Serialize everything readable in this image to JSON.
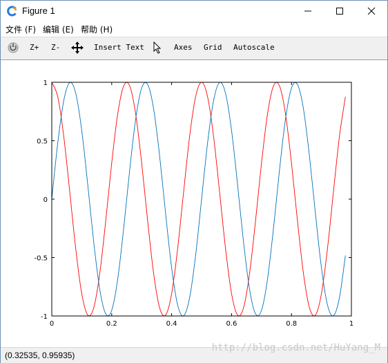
{
  "window": {
    "title": "Figure 1"
  },
  "menu": {
    "items": [
      "文件 (F)",
      "编辑 (E)",
      "帮助 (H)"
    ]
  },
  "toolbar": {
    "zoom_in": "Z+",
    "zoom_out": "Z-",
    "insert_text": "Insert Text",
    "axes": "Axes",
    "grid": "Grid",
    "autoscale": "Autoscale"
  },
  "status": {
    "coords": "(0.32535, 0.95935)",
    "watermark": "http://blog.csdn.net/HuYang_M"
  },
  "colors": {
    "series_red": "#ff0000",
    "series_blue": "#0072bd"
  },
  "chart_data": {
    "type": "line",
    "title": "",
    "xlabel": "",
    "ylabel": "",
    "xlim": [
      0,
      1
    ],
    "ylim": [
      -1,
      1
    ],
    "x_ticks": [
      "0",
      "0.2",
      "0.4",
      "0.6",
      "0.8",
      "1"
    ],
    "y_ticks": [
      "1",
      "0.5",
      "0",
      "-0.5",
      "-1"
    ],
    "grid": false,
    "x": [
      0,
      0.02,
      0.04,
      0.06,
      0.08,
      0.1,
      0.12,
      0.14,
      0.16,
      0.18,
      0.2,
      0.22,
      0.24,
      0.26,
      0.28,
      0.3,
      0.32,
      0.34,
      0.36,
      0.38,
      0.4,
      0.42,
      0.44,
      0.46,
      0.48,
      0.5,
      0.52,
      0.54,
      0.56,
      0.58,
      0.6,
      0.62,
      0.64,
      0.66,
      0.68,
      0.7,
      0.72,
      0.74,
      0.76,
      0.78,
      0.8,
      0.82,
      0.84,
      0.86,
      0.88,
      0.9,
      0.92,
      0.94,
      0.96,
      0.98
    ],
    "series": [
      {
        "color": "#ff0000",
        "values": [
          1,
          0.876,
          0.536,
          0.062,
          -0.426,
          -0.809,
          -0.992,
          -0.93,
          -0.637,
          -0.187,
          0.309,
          0.729,
          0.969,
          0.969,
          0.729,
          0.309,
          -0.187,
          -0.637,
          -0.93,
          -0.992,
          -0.809,
          -0.426,
          0.062,
          0.536,
          0.876,
          1,
          0.876,
          0.536,
          0.062,
          -0.426,
          -0.809,
          -0.992,
          -0.93,
          -0.637,
          -0.187,
          0.309,
          0.729,
          0.969,
          0.969,
          0.729,
          0.309,
          -0.187,
          -0.637,
          -0.93,
          -0.992,
          -0.809,
          -0.426,
          0.062,
          0.536,
          0.876
        ]
      },
      {
        "color": "#0072bd",
        "values": [
          0,
          0.482,
          0.844,
          0.998,
          0.905,
          0.588,
          0.125,
          -0.368,
          -0.771,
          -0.982,
          -0.951,
          -0.685,
          -0.249,
          0.249,
          0.685,
          0.951,
          0.982,
          0.771,
          0.368,
          -0.125,
          -0.588,
          -0.905,
          -0.998,
          -0.844,
          -0.482,
          0,
          0.482,
          0.844,
          0.998,
          0.905,
          0.588,
          0.125,
          -0.368,
          -0.771,
          -0.982,
          -0.951,
          -0.685,
          -0.249,
          0.249,
          0.685,
          0.951,
          0.982,
          0.771,
          0.368,
          -0.125,
          -0.588,
          -0.905,
          -0.998,
          -0.844,
          -0.482
        ]
      }
    ]
  }
}
